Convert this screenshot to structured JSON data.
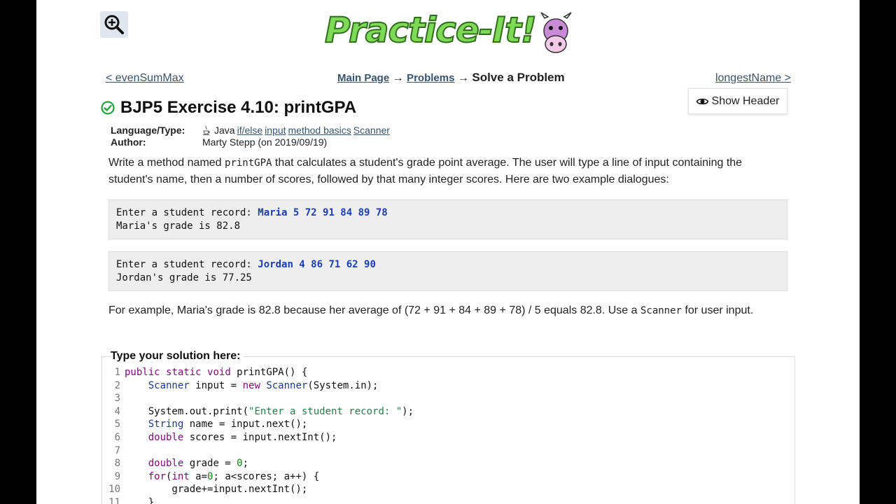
{
  "logo": {
    "text": "Practice-It!"
  },
  "nav": {
    "prev": "< evenSumMax",
    "next": "longestName >",
    "breadcrumb": {
      "main": "Main Page",
      "problems": "Problems",
      "current": "Solve a Problem",
      "arrow": "→"
    }
  },
  "show_header_label": "Show Header",
  "problem": {
    "title": "BJP5 Exercise 4.10: printGPA",
    "language_label": "Language/Type:",
    "language_value": "Java",
    "tags": [
      "if/else",
      "input",
      "method basics",
      "Scanner"
    ],
    "author_label": "Author:",
    "author_value": "Marty Stepp (on 2019/09/19)",
    "desc_before": "Write a method named ",
    "desc_method": "printGPA",
    "desc_after": " that calculates a student's grade point average. The user will type a line of input containing the student's name, then a number of scores, followed by that many integer scores. Here are two example dialogues:",
    "dialogs": [
      {
        "prompt": "Enter a student record: ",
        "input": "Maria 5 72 91 84 89 78",
        "output": "Maria's grade is 82.8"
      },
      {
        "prompt": "Enter a student record: ",
        "input": "Jordan 4 86 71 62 90",
        "output": "Jordan's grade is 77.25"
      }
    ],
    "example_before": "For example, Maria's grade is 82.8 because her average of (72 + 91 + 84 + 89 + 78) / 5 equals 82.8. Use a ",
    "example_code": "Scanner",
    "example_after": " for user input."
  },
  "solution": {
    "legend": "Type your solution here:",
    "lines": [
      "public static void printGPA() {",
      "    Scanner input = new Scanner(System.in);",
      "",
      "    System.out.print(\"Enter a student record: \");",
      "    String name = input.next();",
      "    double scores = input.nextInt();",
      "",
      "    double grade = 0;",
      "    for(int a=0; a<scores; a++) {",
      "        grade+=input.nextInt();",
      "    }"
    ]
  },
  "colors": {
    "link": "#39536b",
    "dialog_input": "#1a3fb0",
    "check": "#22a33a"
  }
}
